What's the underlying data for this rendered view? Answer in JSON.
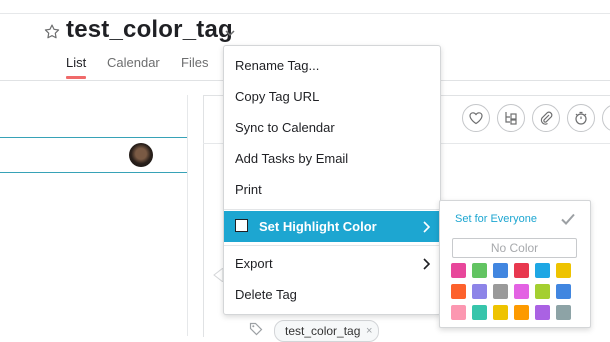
{
  "header": {
    "title": "test_color_tag",
    "tabs": [
      {
        "label": "List",
        "active": true
      },
      {
        "label": "Calendar",
        "active": false
      },
      {
        "label": "Files",
        "active": false
      }
    ]
  },
  "menu": {
    "items": [
      {
        "label": "Rename Tag..."
      },
      {
        "label": "Copy Tag URL"
      },
      {
        "label": "Sync to Calendar"
      },
      {
        "label": "Add Tasks by Email"
      },
      {
        "label": "Print"
      },
      {
        "label": "Set Highlight Color",
        "highlighted": true,
        "submenu": true
      },
      {
        "label": "Export",
        "submenu": true
      },
      {
        "label": "Delete Tag"
      }
    ]
  },
  "palette": {
    "title": "Set for Everyone",
    "no_color": "No Color",
    "colors": [
      "#e8479b",
      "#62c462",
      "#4186e0",
      "#e8384f",
      "#1ea7e4",
      "#eec300",
      "#fd612c",
      "#8d84e8",
      "#9a9a9a",
      "#e362e3",
      "#a4cf30",
      "#4186e0",
      "#fc97b1",
      "#37c5ab",
      "#eec300",
      "#fd9a00",
      "#aa62e3",
      "#8da3a6"
    ]
  },
  "tag_chip": {
    "label": "test_color_tag",
    "remove": "×"
  },
  "colors": {
    "accent": "#1da6d1",
    "tab_underline": "#f06a6a",
    "selection_line": "#37a2b7"
  }
}
